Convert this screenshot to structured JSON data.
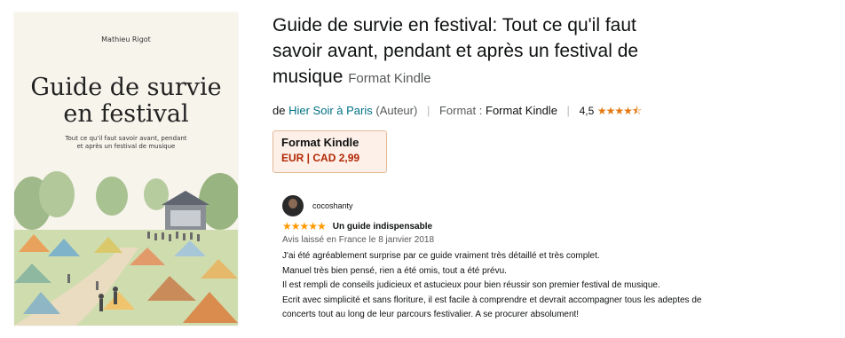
{
  "book": {
    "cover_author": "Mathieu Rigot",
    "cover_title_line1": "Guide de survie",
    "cover_title_line2": "en festival",
    "cover_subtitle_line1": "Tout ce qu'il faut savoir avant, pendant",
    "cover_subtitle_line2": "et après un festival de musique"
  },
  "product": {
    "title": "Guide de survie en festival: Tout ce qu'il faut savoir avant, pendant et après un festival de musique",
    "format_inline": "Format Kindle",
    "byline_prefix": "de",
    "author_link": "Hier Soir à Paris",
    "author_role": "(Auteur)",
    "format_label": "Format :",
    "format_value": "Format Kindle",
    "rating": "4,5",
    "rating_stars": "★★★★⯪"
  },
  "format_box": {
    "name": "Format Kindle",
    "price": "EUR | CAD  2,99"
  },
  "review": {
    "reviewer": "cocoshanty",
    "stars": "★★★★★",
    "title": "Un guide indispensable",
    "meta": "Avis laissé en France le 8 janvier 2018",
    "lines": [
      "J'ai été agréablement surprise par ce guide vraiment très détaillé et très complet.",
      "Manuel très bien pensé, rien a été omis, tout a été prévu.",
      "Il est rempli de conseils judicieux et astucieux pour bien réussir son premier festival de musique.",
      "Ecrit avec simplicité et sans floriture, il est facile à comprendre et devrait accompagner tous les adeptes de",
      "concerts tout au long de leur parcours festivalier. A se procurer absolument!"
    ]
  },
  "colors": {
    "link": "#007185",
    "price": "#b12704",
    "star": "#ff9900",
    "format_box_bg": "#fdf0e8",
    "format_box_border": "#e3b99a"
  },
  "icons": {
    "avatar": "user-avatar-icon",
    "stars": "star-icon"
  }
}
